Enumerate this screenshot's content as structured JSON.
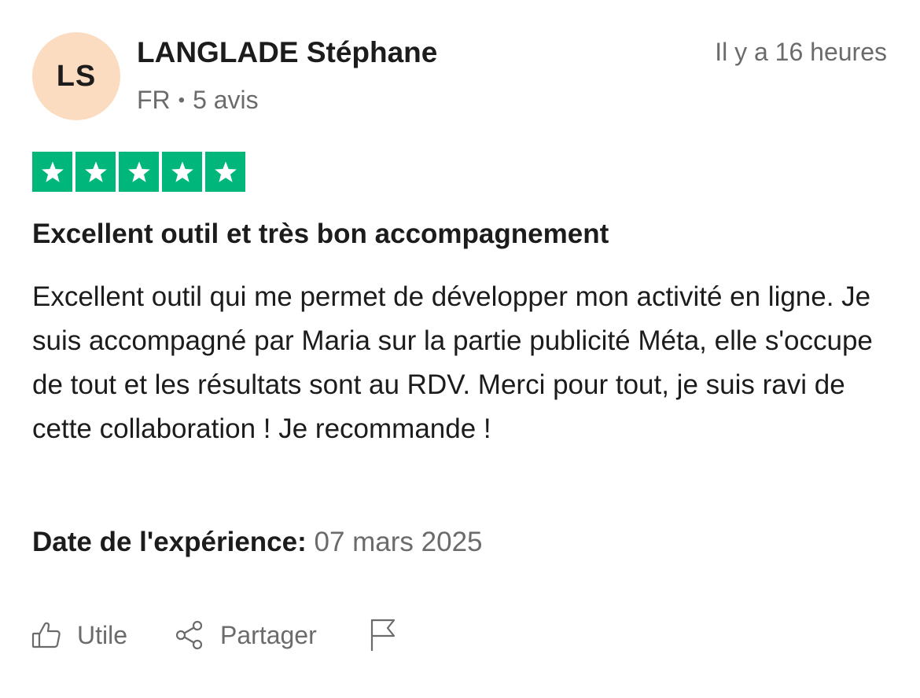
{
  "reviewer": {
    "initials": "LS",
    "name": "LANGLADE Stéphane",
    "country": "FR",
    "separator": "•",
    "reviews_count": "5 avis",
    "avatar_color": "#fcdcc0"
  },
  "review": {
    "posted": "Il y a 16 heures",
    "rating": 5,
    "rating_max": 5,
    "star_color": "#00b67a",
    "title": "Excellent outil et très bon accompagnement",
    "body": "Excellent outil qui me permet de développer mon activité en ligne. Je suis accompagné par Maria sur la partie publicité Méta, elle s'occupe de tout et les résultats sont au RDV. Merci pour tout, je suis ravi de cette collaboration ! Je recommande !",
    "experience_label": "Date de l'expérience:",
    "experience_date": "07 mars 2025"
  },
  "actions": {
    "useful_label": "Utile",
    "useful_icon": "thumbs-up-icon",
    "share_label": "Partager",
    "share_icon": "share-icon",
    "report_icon": "flag-icon"
  }
}
